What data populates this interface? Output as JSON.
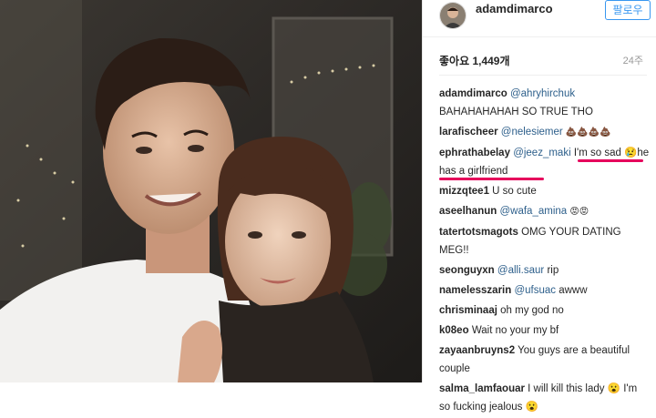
{
  "post": {
    "username": "adamdimarco",
    "follow_label": "팔로우",
    "likes": "좋아요 1,449개",
    "time": "24주"
  },
  "comments": [
    {
      "user": "adamdimarco",
      "mention": "@ahryhirchuk",
      "text": "BAHAHAHAHAH SO TRUE THO"
    },
    {
      "user": "larafischeer",
      "mention": "@nelesiemer",
      "text": "💩💩💩💩"
    },
    {
      "user": "ephrathabelay",
      "mention": "@jeez_maki",
      "text": "I'm so sad 😢he has a girlfriend"
    },
    {
      "user": "mizzqtee1",
      "mention": "",
      "text": "U so cute"
    },
    {
      "user": "aseelhanun",
      "mention": "@wafa_amina",
      "text": "😡😡"
    },
    {
      "user": "tatertotsmagots",
      "mention": "",
      "text": "OMG YOUR DATING MEG!!"
    },
    {
      "user": "seonguyxn",
      "mention": "@alli.saur",
      "text": "rip"
    },
    {
      "user": "namelesszarin",
      "mention": "@ufsuac",
      "text": "awww"
    },
    {
      "user": "chrisminaaj",
      "mention": "",
      "text": "oh my god no"
    },
    {
      "user": "k08eo",
      "mention": "",
      "text": "Wait no your my bf"
    },
    {
      "user": "zayaanbruyns2",
      "mention": "",
      "text": "You guys are a beautiful couple"
    },
    {
      "user": "salma_lamfaouar",
      "mention": "",
      "text": "I will kill this lady 😮 I'm so fucking jealous 😮"
    }
  ],
  "colors": {
    "mention": "#2d5f8b",
    "highlight": "#e6005c",
    "follow": "#3897f0"
  }
}
